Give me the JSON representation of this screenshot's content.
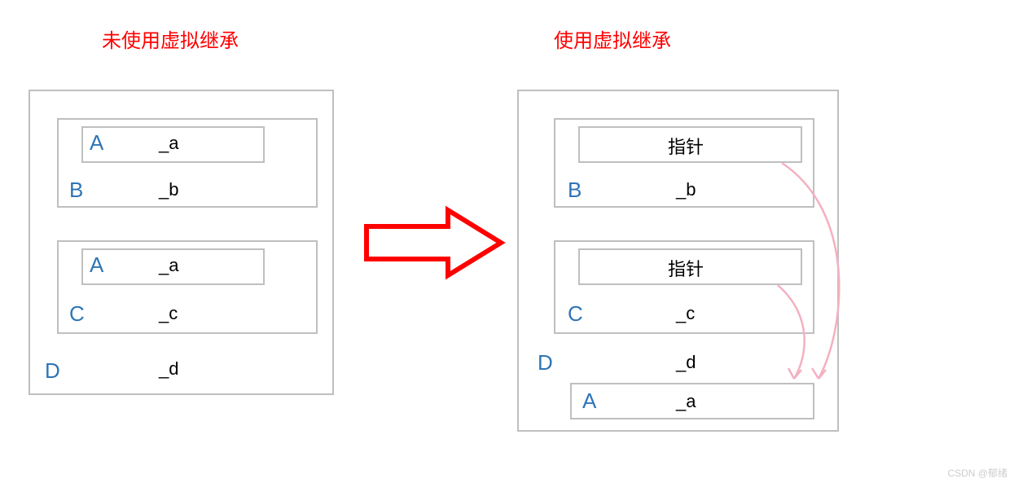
{
  "titles": {
    "left": "未使用虚拟继承",
    "right": "使用虚拟继承"
  },
  "labels": {
    "A": "A",
    "B": "B",
    "C": "C",
    "D": "D",
    "pointer": "指针"
  },
  "members": {
    "a": "_a",
    "b": "_b",
    "c": "_c",
    "d": "_d"
  },
  "watermark": "CSDN @郁绪"
}
